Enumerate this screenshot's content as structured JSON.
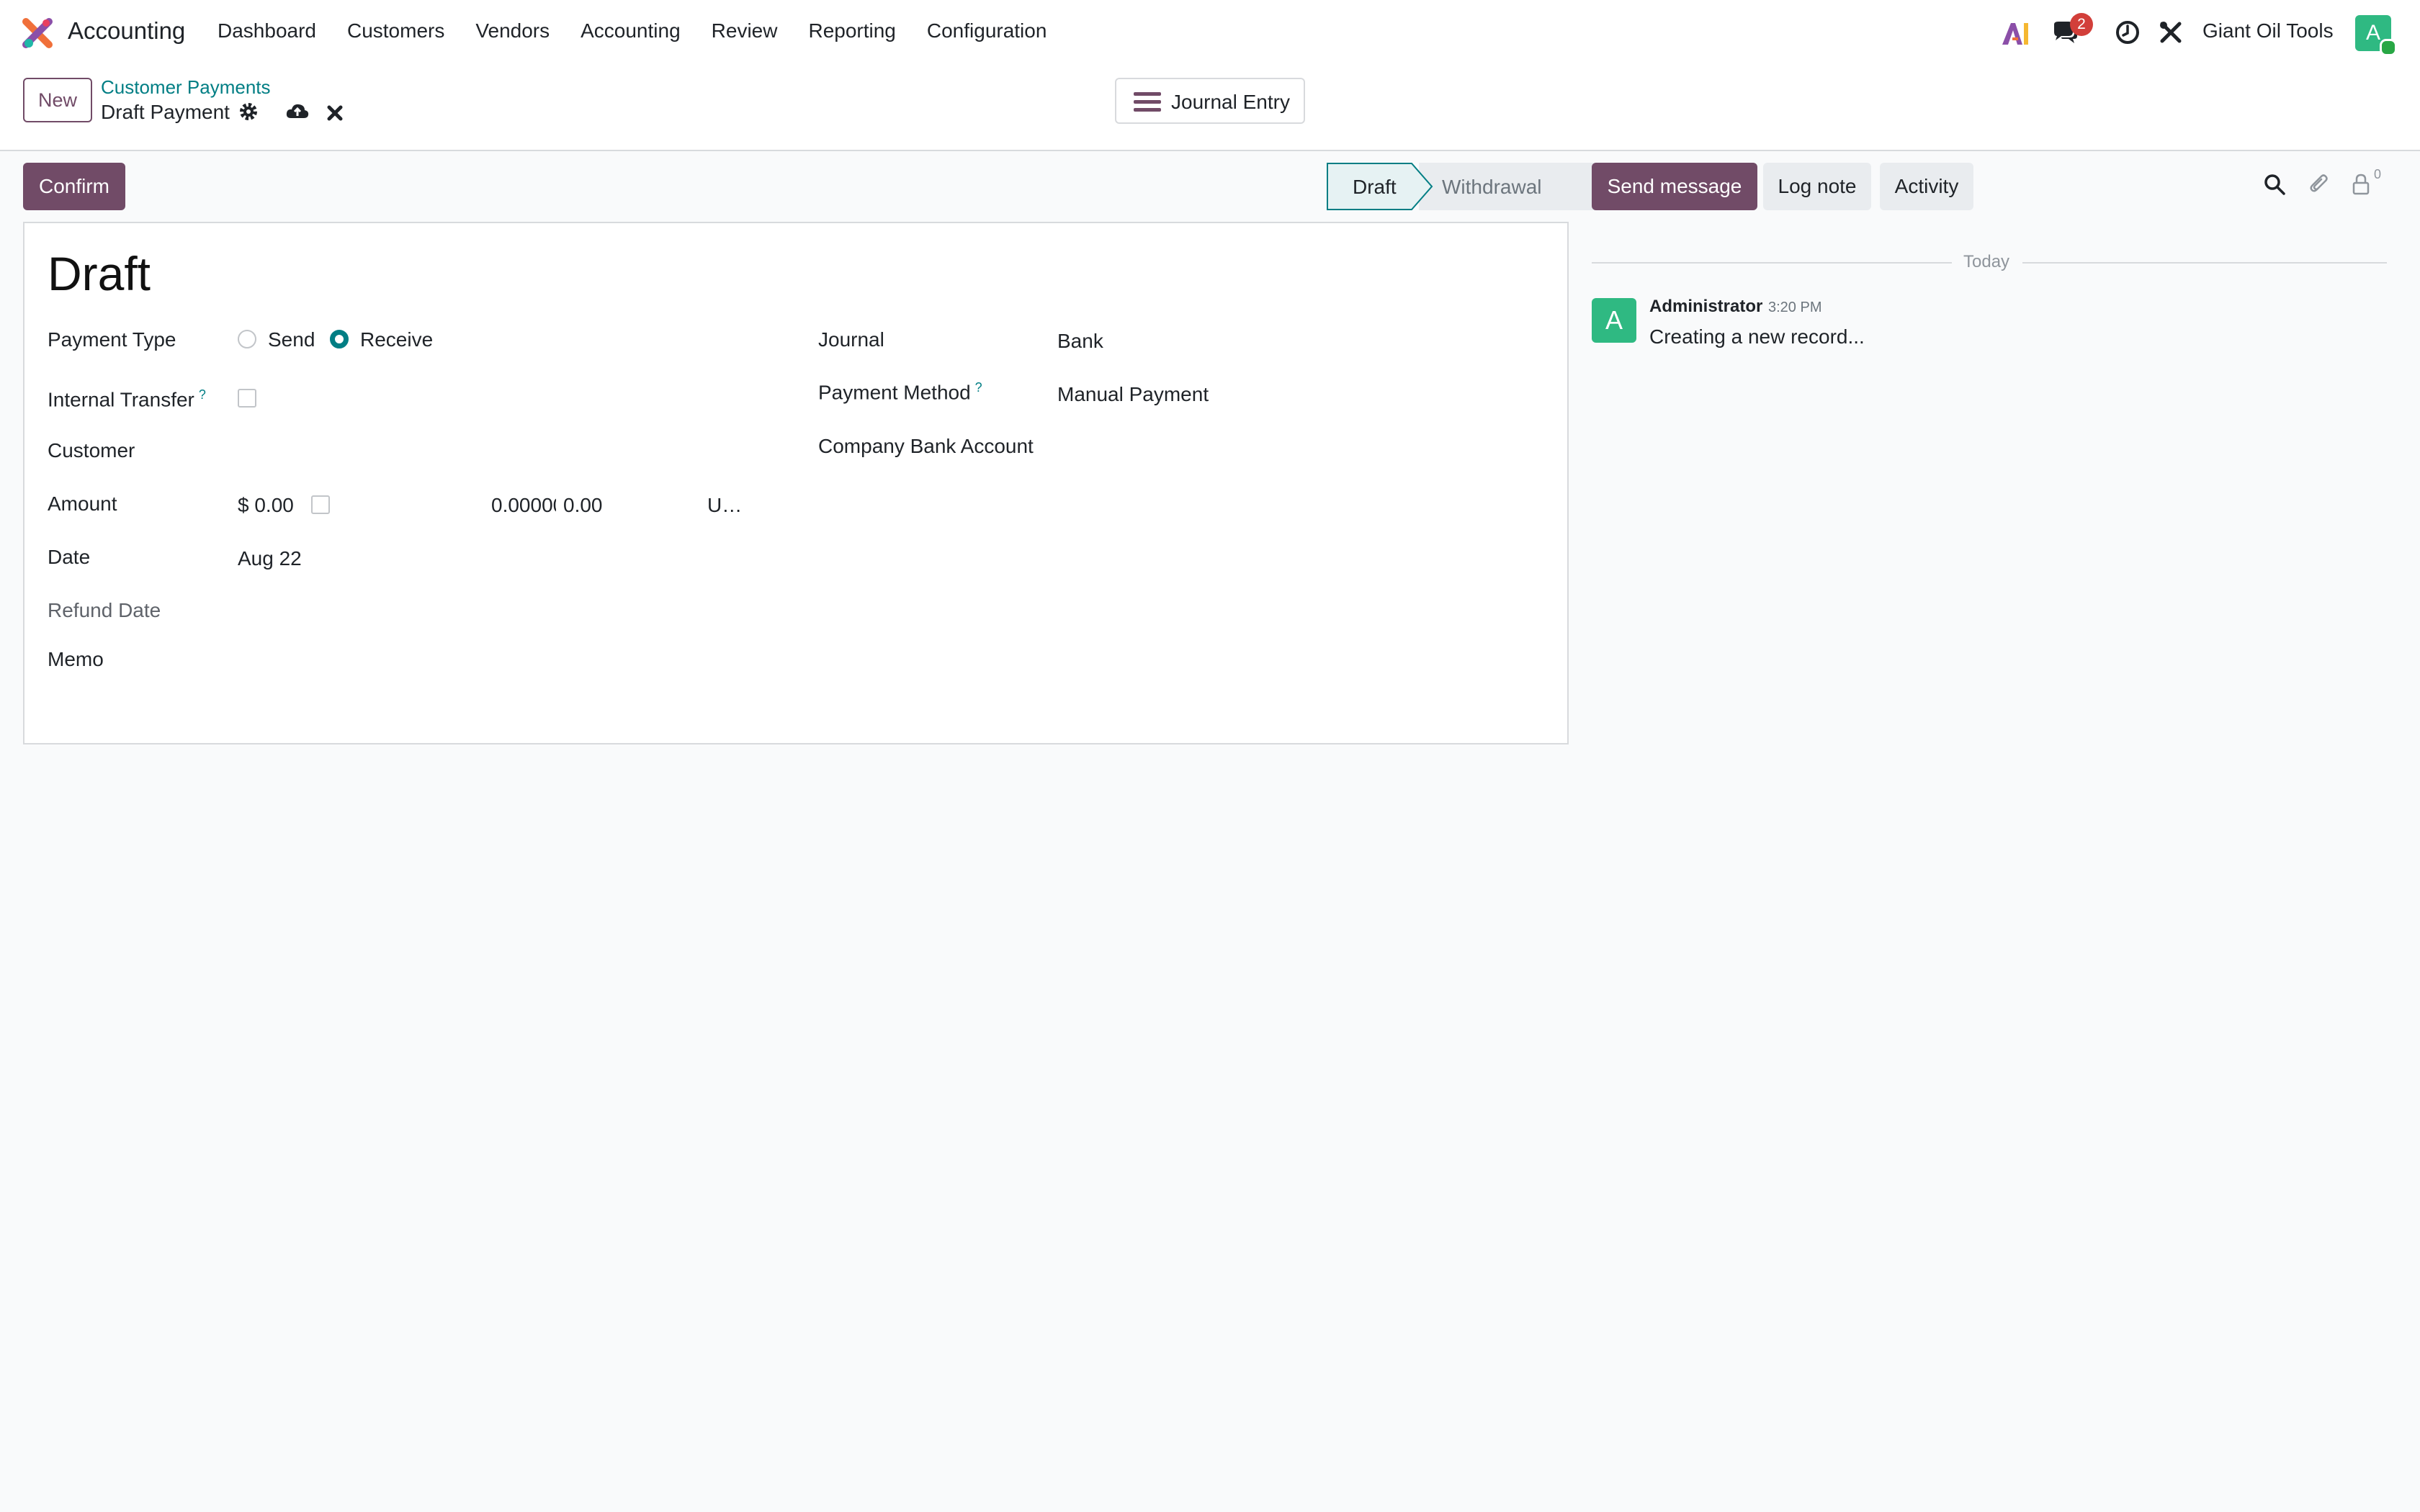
{
  "app": {
    "name": "Accounting",
    "company": "Giant Oil Tools",
    "user_initial": "A",
    "message_count": "2"
  },
  "menu": [
    "Dashboard",
    "Customers",
    "Vendors",
    "Accounting",
    "Review",
    "Reporting",
    "Configuration"
  ],
  "control": {
    "new_label": "New",
    "breadcrumb_parent": "Customer Payments",
    "breadcrumb_current": "Draft Payment",
    "smart_button": "Journal Entry"
  },
  "status": {
    "confirm_label": "Confirm",
    "stages": [
      "Draft",
      "Withdrawal"
    ],
    "active": "Draft"
  },
  "form": {
    "title": "Draft",
    "payment_type": {
      "label": "Payment Type",
      "options": [
        "Send",
        "Receive"
      ],
      "selected": "Receive"
    },
    "internal_transfer": {
      "label": "Internal Transfer",
      "help": "?"
    },
    "customer": {
      "label": "Customer",
      "value": ""
    },
    "amount": {
      "label": "Amount",
      "value": "$ 0.00",
      "rate": "0.00000",
      "company_amount": "0.00",
      "currency": "U…"
    },
    "date": {
      "label": "Date",
      "value": "Aug 22"
    },
    "refund_date": {
      "label": "Refund Date"
    },
    "memo": {
      "label": "Memo"
    },
    "journal": {
      "label": "Journal",
      "value": "Bank"
    },
    "payment_method": {
      "label": "Payment Method",
      "help": "?",
      "value": "Manual Payment"
    },
    "company_bank_account": {
      "label": "Company Bank Account",
      "value": ""
    }
  },
  "chatter": {
    "send_message": "Send message",
    "log_note": "Log note",
    "activity": "Activity",
    "followers": "0",
    "date_separator": "Today",
    "messages": [
      {
        "avatar": "A",
        "author": "Administrator",
        "time": "3:20 PM",
        "body": "Creating a new record..."
      }
    ]
  },
  "colors": {
    "primary": "#714b67",
    "accent": "#017e84",
    "avatar": "#2fb982",
    "badge": "#d23f3a"
  }
}
